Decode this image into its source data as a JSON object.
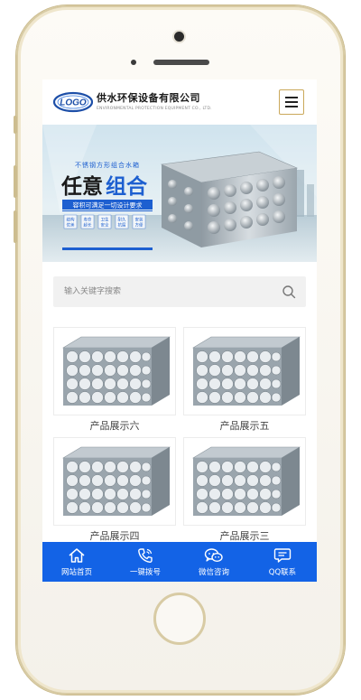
{
  "header": {
    "logo_text": "LOGO",
    "company_name": "供水环保设备有限公司",
    "company_en": "ENVIRONMENTAL PROTECTION EQUIPMENT CO., LTD."
  },
  "banner": {
    "top_line": "不锈钢方形组合水箱",
    "headline_part1": "任意",
    "headline_part2": "组合",
    "subline": "容积可满足一切设计要求",
    "features": [
      {
        "line1": "结构",
        "line2": "优美"
      },
      {
        "line1": "寿命",
        "line2": "超长"
      },
      {
        "line1": "卫生",
        "line2": "安全"
      },
      {
        "line1": "耐久",
        "line2": "抗腐"
      },
      {
        "line1": "安装",
        "line2": "方便"
      }
    ]
  },
  "search": {
    "placeholder": "输入关键字搜索"
  },
  "products": [
    {
      "caption": "产品展示六"
    },
    {
      "caption": "产品展示五"
    },
    {
      "caption": "产品展示四"
    },
    {
      "caption": "产品展示三"
    }
  ],
  "bottom_nav": [
    {
      "label": "网站首页",
      "icon": "home-icon"
    },
    {
      "label": "一键拨号",
      "icon": "phone-icon"
    },
    {
      "label": "微信咨询",
      "icon": "wechat-icon"
    },
    {
      "label": "QQ联系",
      "icon": "message-icon"
    }
  ],
  "colors": {
    "accent": "#1363e6",
    "banner_blue": "#1d5fd0",
    "menu_border": "#caa85a",
    "phone_frame": "#d8cba4"
  }
}
